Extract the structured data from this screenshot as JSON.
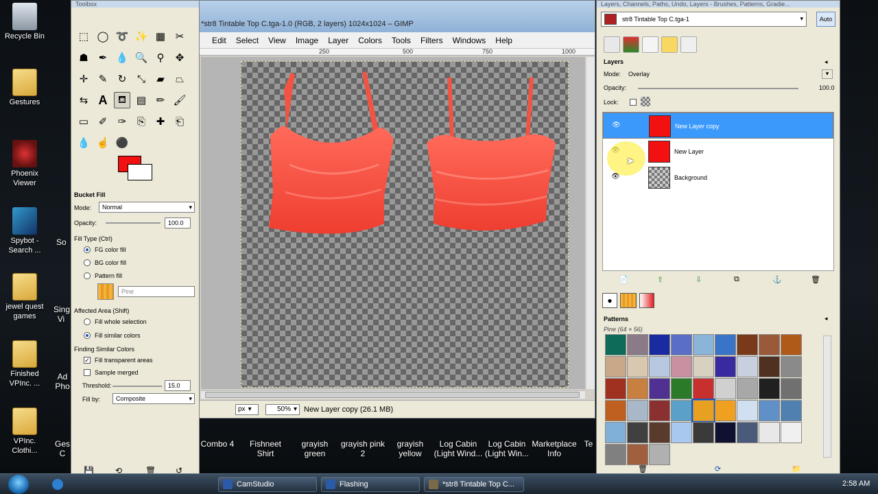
{
  "desktop": {
    "icons": [
      {
        "label": "Recycle Bin"
      },
      {
        "label": "Gestures"
      },
      {
        "label": "Phoenix Viewer"
      },
      {
        "label": "Spybot - Search ..."
      },
      {
        "label": "jewel quest games"
      },
      {
        "label": "Finished VPInc. ..."
      },
      {
        "label": "VPInc. Clothi..."
      }
    ],
    "partial_labels": [
      "So",
      "Sing Vi",
      "Ad Pho",
      "Ges C"
    ],
    "bottom_items": [
      "Combo 4",
      "Fishneet Shirt",
      "grayish green",
      "grayish pink 2",
      "grayish yellow",
      "Log Cabin (Light Wind...",
      "Log Cabin (Light Win...",
      "Marketplace Info",
      "Te"
    ]
  },
  "image_window": {
    "title": "*str8 Tintable Top C.tga-1.0 (RGB, 2 layers) 1024x1024 – GIMP",
    "menu": [
      "Edit",
      "Select",
      "View",
      "Image",
      "Layer",
      "Colors",
      "Tools",
      "Filters",
      "Windows",
      "Help"
    ],
    "ruler_ticks": [
      "250",
      "500",
      "750",
      "1000"
    ],
    "unit": "px",
    "zoom": "50%",
    "status": "New Layer copy (26.1 MB)"
  },
  "toolbox": {
    "title": "Toolbox",
    "tool_options_title": "Bucket Fill",
    "mode_label": "Mode:",
    "mode_value": "Normal",
    "opacity_label": "Opacity:",
    "opacity_value": "100.0",
    "fill_type_label": "Fill Type  (Ctrl)",
    "fill_types": [
      "FG color fill",
      "BG color fill",
      "Pattern fill"
    ],
    "pattern_name": "Pine",
    "affected_area_label": "Affected Area  (Shift)",
    "affected_areas": [
      "Fill whole selection",
      "Fill similar colors"
    ],
    "finding_label": "Finding Similar Colors",
    "fill_transparent": "Fill transparent areas",
    "sample_merged": "Sample merged",
    "threshold_label": "Threshold:",
    "threshold_value": "15.0",
    "fill_by_label": "Fill by:",
    "fill_by_value": "Composite",
    "fg_color": "#f21010",
    "bg_color": "#ffffff"
  },
  "dock": {
    "title": "Layers, Channels, Paths, Undo, Layers - Brushes, Patterns, Gradie...",
    "image_name": "str8 Tintable Top C.tga-1",
    "auto_label": "Auto",
    "layers_title": "Layers",
    "mode_label": "Mode:",
    "mode_value": "Overlay",
    "opacity_label": "Opacity:",
    "opacity_value": "100.0",
    "lock_label": "Lock:",
    "layers": [
      {
        "name": "New Layer copy",
        "selected": true
      },
      {
        "name": "New Layer",
        "selected": false
      },
      {
        "name": "Background",
        "selected": false
      }
    ],
    "patterns_title": "Patterns",
    "pattern_caption": "Pine (64 × 56)"
  },
  "taskbar": {
    "buttons": [
      "CamStudio",
      "Flashing",
      "*str8 Tintable Top C..."
    ],
    "clock": "2:58 AM"
  }
}
